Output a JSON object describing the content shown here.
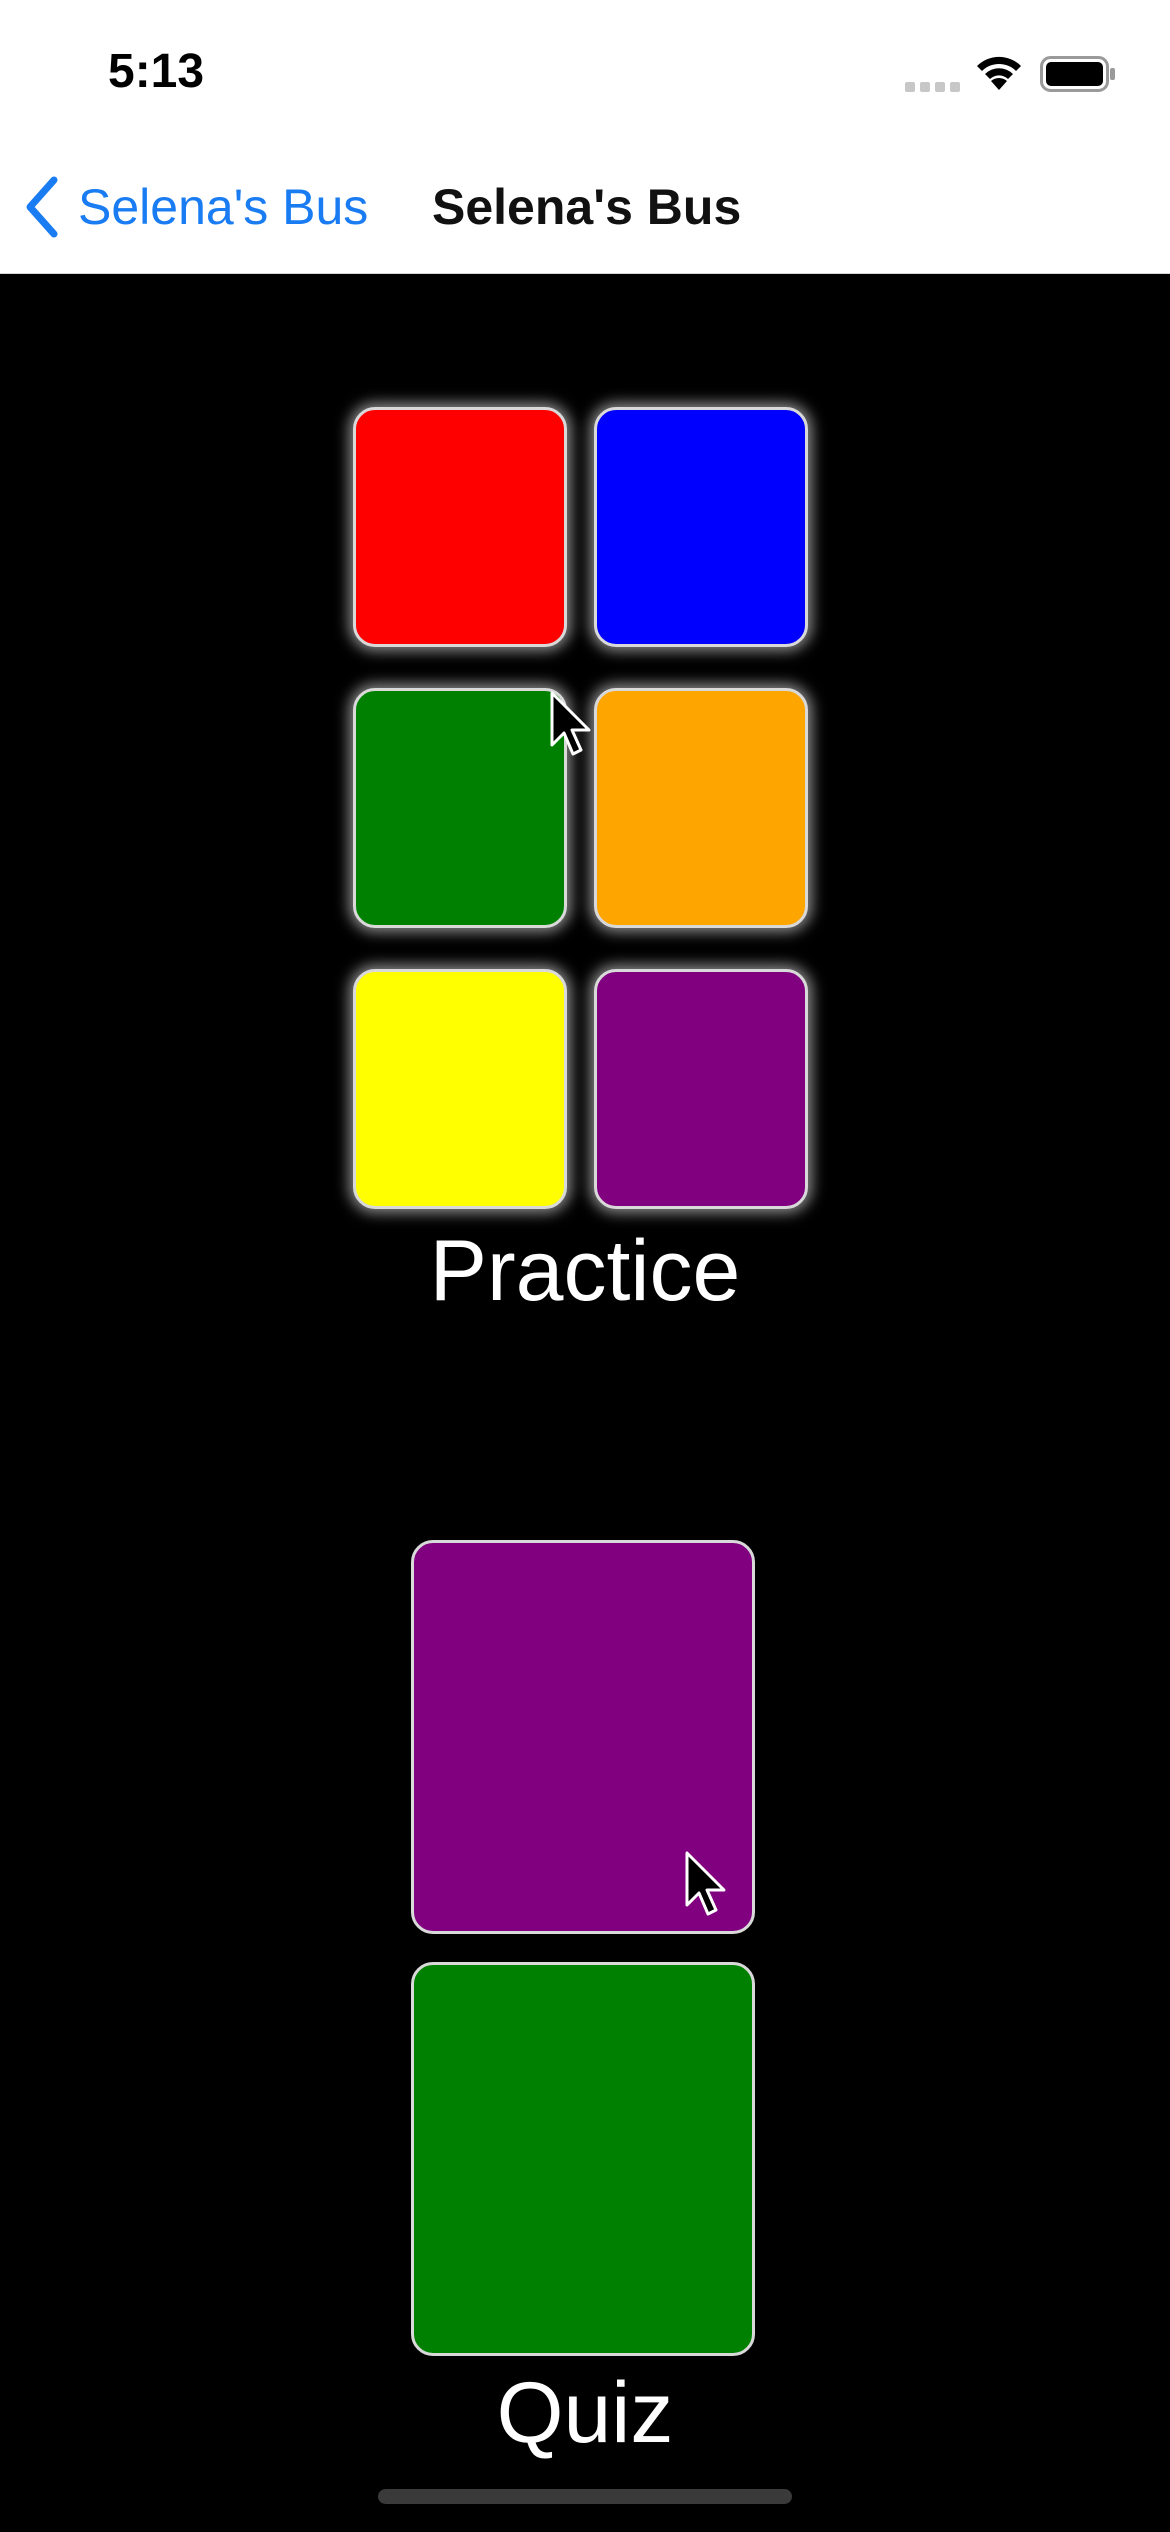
{
  "status_bar": {
    "time": "5:13"
  },
  "nav": {
    "back_label": "Selena's Bus",
    "title": "Selena's Bus"
  },
  "practice": {
    "label": "Practice",
    "tiles": [
      {
        "name": "red",
        "color": "#ff0000"
      },
      {
        "name": "blue",
        "color": "#0000ff"
      },
      {
        "name": "green",
        "color": "#008000"
      },
      {
        "name": "orange",
        "color": "#ffa500"
      },
      {
        "name": "yellow",
        "color": "#ffff00"
      },
      {
        "name": "purple",
        "color": "#800080"
      }
    ]
  },
  "quiz": {
    "label": "Quiz",
    "tiles": [
      {
        "name": "purple",
        "color": "#800080"
      },
      {
        "name": "green",
        "color": "#008000"
      }
    ]
  }
}
